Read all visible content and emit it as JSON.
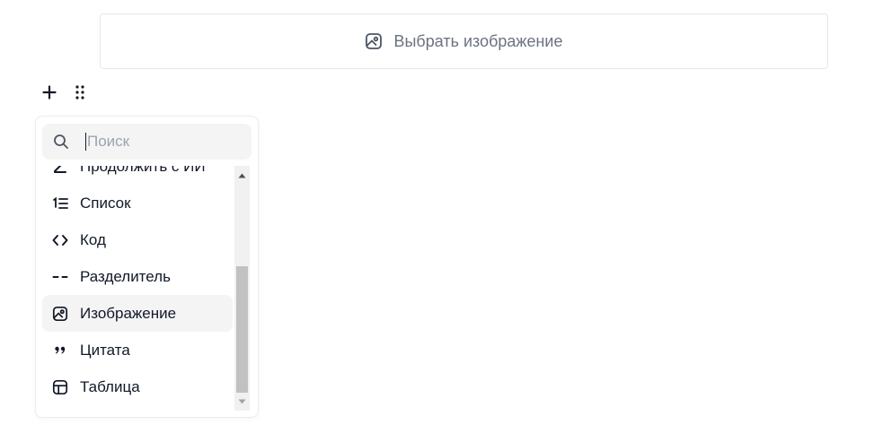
{
  "image_picker": {
    "label": "Выбрать изображение",
    "icon": "image-icon"
  },
  "block_controls": {
    "add_icon": "plus-icon",
    "drag_icon": "drag-handle-icon"
  },
  "insert_menu": {
    "search": {
      "placeholder": "Поиск",
      "value": "",
      "icon": "search-icon"
    },
    "items": [
      {
        "label": "Продолжить с ИИ",
        "icon": "ai-pen-icon"
      },
      {
        "label": "Список",
        "icon": "numbered-list-icon"
      },
      {
        "label": "Код",
        "icon": "code-icon"
      },
      {
        "label": "Разделитель",
        "icon": "divider-icon"
      },
      {
        "label": "Изображение",
        "icon": "image-icon",
        "active": true
      },
      {
        "label": "Цитата",
        "icon": "quote-icon"
      },
      {
        "label": "Таблица",
        "icon": "table-icon"
      }
    ]
  },
  "colors": {
    "text": "#111827",
    "muted": "#6b7280",
    "placeholder": "#9ca3af",
    "hover_bg": "#f4f4f5",
    "border": "#e5e7eb"
  }
}
